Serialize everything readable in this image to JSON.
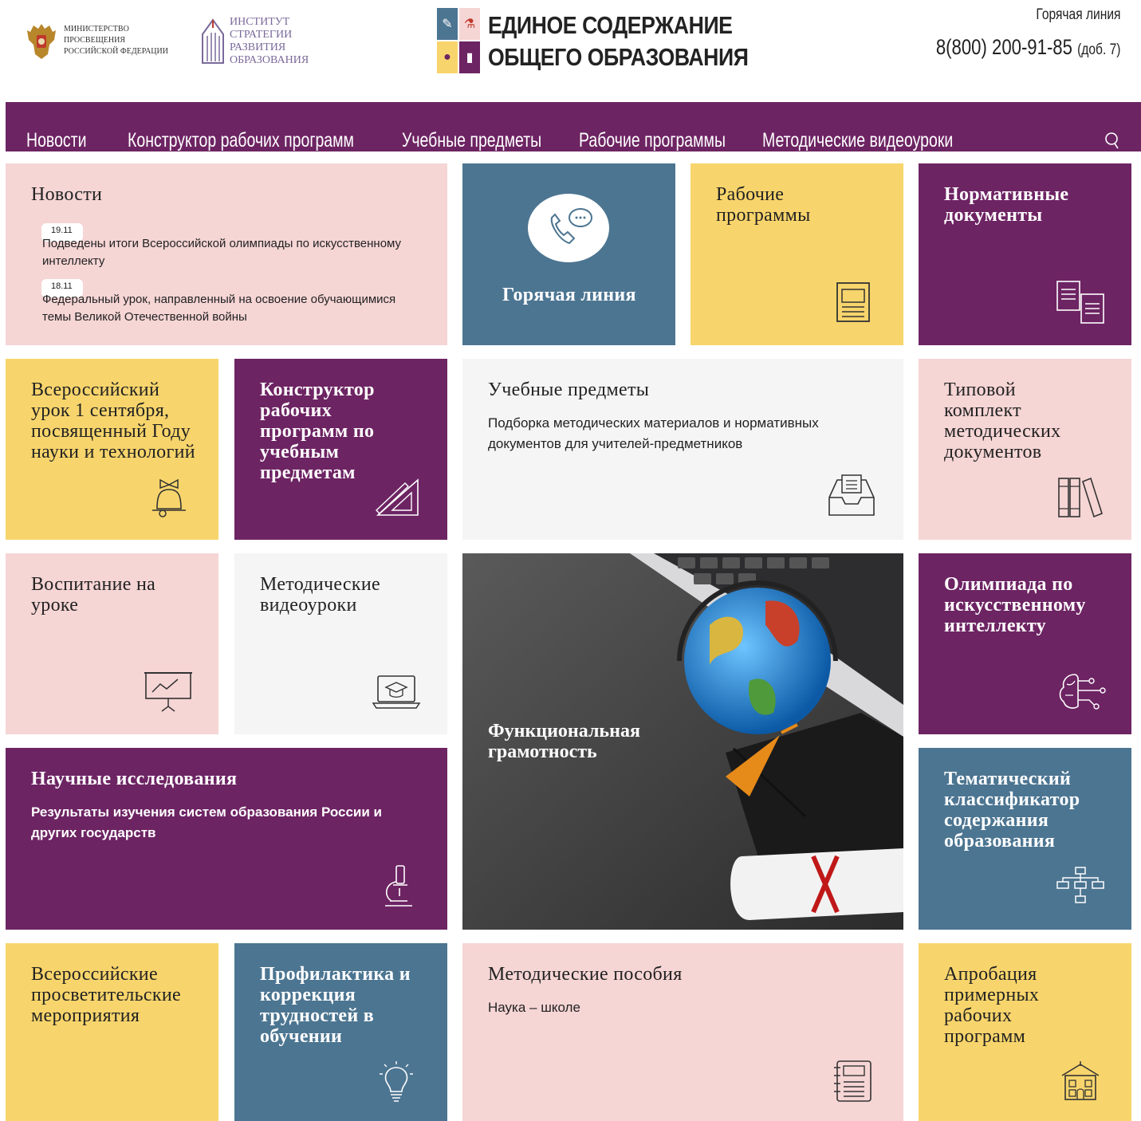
{
  "header": {
    "ministry_logo_text": "Министерство просвещения Российской Федерации",
    "institute_logo_text": "Институт стратегии развития образования",
    "site_title_line1": "ЕДИНОЕ СОДЕРЖАНИЕ",
    "site_title_line2": "ОБЩЕГО ОБРАЗОВАНИЯ",
    "hotline_label": "Горячая линия",
    "hotline_phone": "8(800) 200-91-85",
    "hotline_ext": "(доб. 7)"
  },
  "nav": {
    "items": [
      "Новости",
      "Конструктор рабочих программ",
      "Учебные предметы",
      "Рабочие программы",
      "Методические видеоуроки"
    ]
  },
  "tiles": {
    "news": {
      "title": "Новости",
      "items": [
        {
          "date": "19.11",
          "text": "Подведены итоги Всероссийской олимпиады по искусственному интеллекту"
        },
        {
          "date": "18.11",
          "text": "Федеральный урок, направленный на освоение обучающимися темы Великой Отечественной войны"
        }
      ]
    },
    "hotline": {
      "title": "Горячая линия"
    },
    "work_programs": {
      "title": "Рабочие программы"
    },
    "normative_docs": {
      "title": "Нормативные документы"
    },
    "lesson_sept1": {
      "title": "Всероссийский урок 1 сентября, посвященный Году науки и технологий"
    },
    "constructor": {
      "title": "Конструктор рабочих программ по учебным предметам"
    },
    "subjects": {
      "title": "Учебные предметы",
      "desc": "Подборка методических материалов и нормативных документов для учителей-предметников"
    },
    "typical_kit": {
      "title": "Типовой комплект методических документов"
    },
    "upbringing": {
      "title": "Воспитание на уроке"
    },
    "video_lessons": {
      "title": "Методические видеоуроки"
    },
    "functional_literacy": {
      "title": "Функциональная грамотность"
    },
    "ai_olympiad": {
      "title": "Олимпиада по искусственному интеллекту"
    },
    "research": {
      "title": "Научные исследования",
      "desc": "Результаты изучения систем образования России и других государств"
    },
    "classifier": {
      "title": "Тематический классификатор содержания образования"
    },
    "events": {
      "title": "Всероссийские просветительские мероприятия"
    },
    "prevention": {
      "title": "Профилактика и коррекция трудностей в обучении"
    },
    "manuals": {
      "title": "Методические пособия",
      "desc": "Наука – школе"
    },
    "approbation": {
      "title": "Апробация примерных рабочих программ"
    }
  },
  "colors": {
    "purple": "#6d2463",
    "pink": "#f6d5d5",
    "yellow": "#f8d56c",
    "blue": "#4c7591",
    "light": "#f5f5f5"
  }
}
